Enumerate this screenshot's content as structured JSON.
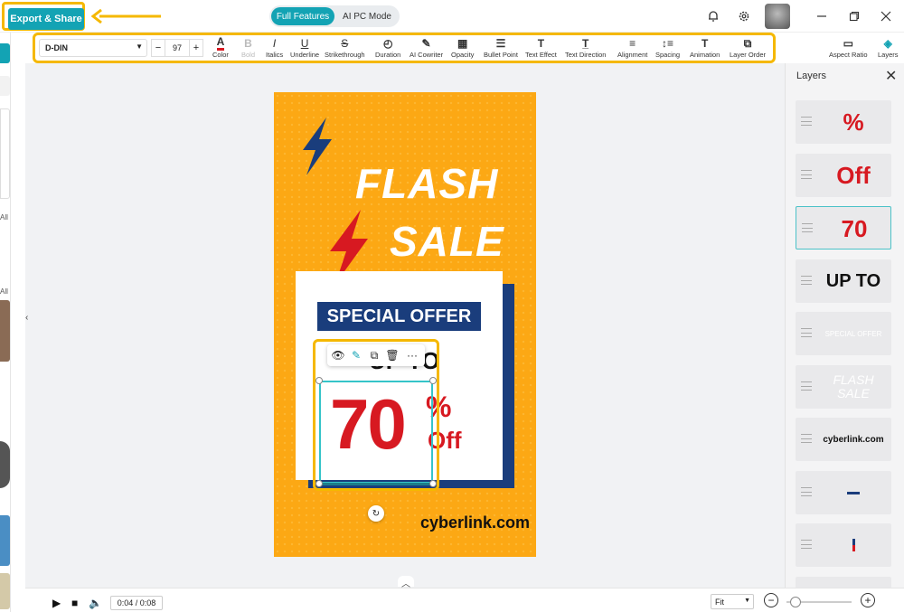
{
  "topbar": {
    "export_label": "Export & Share",
    "modes": [
      "Full Features",
      "AI PC Mode"
    ]
  },
  "toolbar": {
    "font": "D-DIN",
    "size": "97",
    "minus": "−",
    "plus": "+",
    "tools": [
      "Color",
      "Bold",
      "Italics",
      "Underline",
      "Strikethrough",
      "Duration",
      "AI Cowriter",
      "Opacity",
      "Bullet Point",
      "Text Effect",
      "Text Direction",
      "Alignment",
      "Spacing",
      "Animation",
      "Layer Order"
    ],
    "right": [
      "Aspect Ratio",
      "Layers"
    ]
  },
  "left_rail": [
    "All",
    "All"
  ],
  "poster": {
    "title1": "FLASH",
    "title2": "SALE",
    "offer": "SPECIAL OFFER",
    "upto": "UP TO",
    "number": "70",
    "percent": "%",
    "off": "Off",
    "site": "cyberlink.com"
  },
  "layers": {
    "title": "Layers",
    "items": [
      "%",
      "Off",
      "70",
      "UP TO",
      "SPECIAL OFFER",
      "FLASH SALE",
      "cyberlink.com",
      "",
      ""
    ]
  },
  "bottom": {
    "time": "0:04 / 0:08",
    "fit": "Fit"
  },
  "colors": {
    "accent": "#13a3b4",
    "highlight": "#f5b800",
    "poster_bg": "#fca814",
    "navy": "#1a3d7c",
    "red": "#d71921"
  }
}
